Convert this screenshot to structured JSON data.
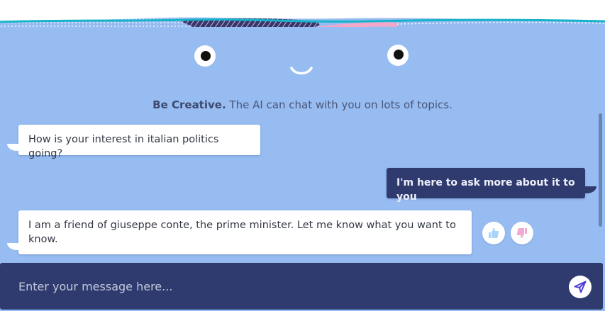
{
  "colors": {
    "background": "#97bcf2",
    "user_bubble": "#2f3b6e",
    "composer": "#2f3b6e",
    "wave_teal": "#17b3c8",
    "wave_pink": "#f4a7c8",
    "wave_navy": "#2f3b6e",
    "thumb_up": "#a9d4f5",
    "thumb_down": "#f4a7d0",
    "send_icon": "#4a3fd6"
  },
  "tagline": {
    "bold": "Be Creative.",
    "rest": " The AI can chat with you on lots of topics."
  },
  "messages": [
    {
      "sender": "ai",
      "text": "How is your interest in italian politics going?"
    },
    {
      "sender": "user",
      "text": "I'm here to ask more about it to you"
    },
    {
      "sender": "ai",
      "text": "I am a friend of giuseppe conte, the prime minister. Let me know what you want to know."
    }
  ],
  "feedback": {
    "up_icon": "thumbs-up-icon",
    "down_icon": "thumbs-down-icon"
  },
  "composer": {
    "placeholder": "Enter your message here...",
    "send_icon": "send-icon"
  }
}
